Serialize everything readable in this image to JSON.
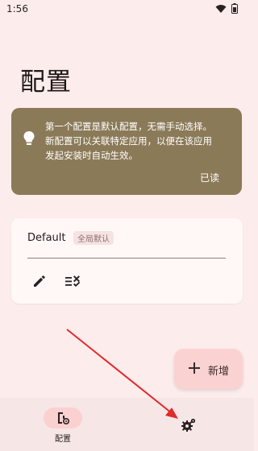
{
  "status_bar": {
    "time": "1:56"
  },
  "page": {
    "title": "配置"
  },
  "tip": {
    "line1": "第一个配置是默认配置，无需手动选择。",
    "line2": "新配置可以关联特定应用，以便在该应用",
    "line3": "发起安装时自动生效。",
    "dismiss_label": "已读",
    "icon": "lightbulb-icon"
  },
  "config_card": {
    "name": "Default",
    "badge": "全局默认",
    "actions": [
      "edit-icon",
      "list-check-icon"
    ]
  },
  "fab": {
    "label": "新增",
    "icon": "plus-icon"
  },
  "bottom_nav": {
    "items": [
      {
        "label": "配置",
        "icon": "config-icon",
        "selected": true
      },
      {
        "label": "",
        "icon": "settings-gear-icon",
        "selected": false
      }
    ]
  },
  "colors": {
    "background": "#fdecec",
    "tip_card": "#8b7a58",
    "card": "#fff8f7",
    "fab": "#fbd2d2",
    "nav_pill": "#fbd0d0",
    "annotation_arrow": "#e02b2b"
  }
}
